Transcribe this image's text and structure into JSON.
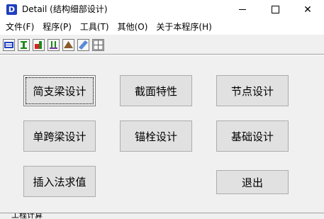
{
  "window": {
    "title": "Detail (结构细部设计)",
    "app_icon_letter": "D",
    "minimize": "–",
    "close": "✕"
  },
  "menu": [
    "文件(F)",
    "程序(P)",
    "工具(T)",
    "其他(O)",
    "关于本程序(H)"
  ],
  "toolbar": {
    "icons": [
      "beam-icon",
      "column-icon",
      "joint-icon",
      "anchor-icon",
      "foundation-icon",
      "cut-icon",
      "grid-icon"
    ]
  },
  "buttons": {
    "simple_beam": "简支梁设计",
    "section": "截面特性",
    "joint": "节点设计",
    "single_span_beam": "单跨梁设计",
    "anchor": "锚栓设计",
    "foundation": "基础设计",
    "interpolation": "插入法求值",
    "exit": "退出"
  },
  "status": {
    "text": "工程计算"
  }
}
